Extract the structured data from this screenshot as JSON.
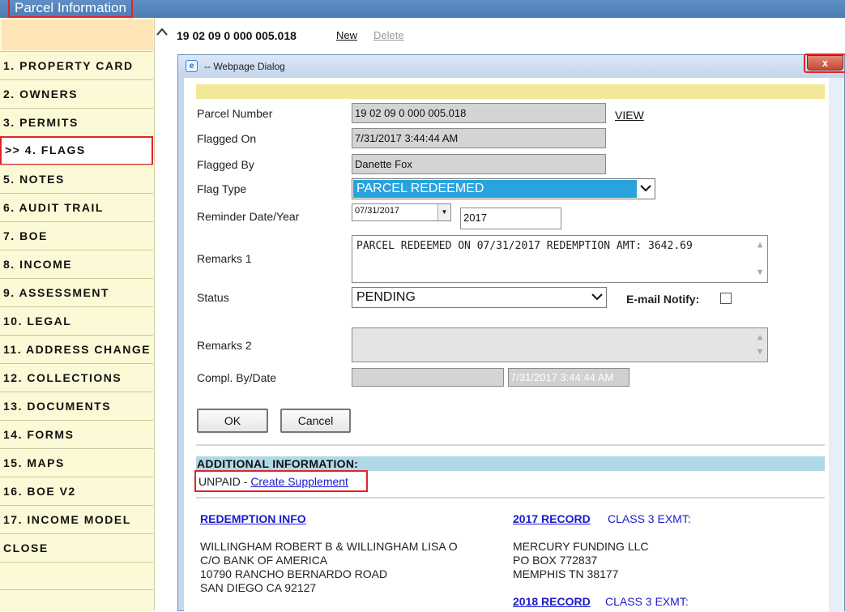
{
  "app": {
    "title": "Parcel Information"
  },
  "nav": {
    "items": [
      {
        "label": "1. PROPERTY CARD"
      },
      {
        "label": "2. OWNERS"
      },
      {
        "label": "3. PERMITS"
      },
      {
        "label": ">> 4. FLAGS"
      },
      {
        "label": "5. NOTES"
      },
      {
        "label": "6. AUDIT TRAIL"
      },
      {
        "label": "7. BOE"
      },
      {
        "label": "8. INCOME"
      },
      {
        "label": "9. ASSESSMENT"
      },
      {
        "label": "10. LEGAL"
      },
      {
        "label": "11. ADDRESS CHANGE"
      },
      {
        "label": "12. COLLECTIONS"
      },
      {
        "label": "13. DOCUMENTS"
      },
      {
        "label": "14. FORMS"
      },
      {
        "label": "15. MAPS"
      },
      {
        "label": "16. BOE V2"
      },
      {
        "label": "17. INCOME MODEL"
      },
      {
        "label": "CLOSE"
      }
    ]
  },
  "page": {
    "parcel_id": "19 02 09 0 000 005.018",
    "new_label": "New",
    "delete_label": "Delete"
  },
  "dialog": {
    "title": "-- Webpage Dialog",
    "close_label": "x",
    "fields": {
      "parcel_number_label": "Parcel Number",
      "parcel_number_value": "19 02 09 0 000 005.018",
      "view_link": "VIEW",
      "flagged_on_label": "Flagged On",
      "flagged_on_value": "7/31/2017 3:44:44 AM",
      "flagged_by_label": "Flagged By",
      "flagged_by_value": "Danette Fox",
      "flag_type_label": "Flag Type",
      "flag_type_value": "PARCEL REDEEMED",
      "reminder_label": "Reminder Date/Year",
      "reminder_date": "07/31/2017",
      "reminder_year": "2017",
      "remarks1_label": "Remarks 1",
      "remarks1_value": "PARCEL REDEEMED ON 07/31/2017 REDEMPTION AMT: 3642.69",
      "status_label": "Status",
      "status_value": "PENDING",
      "email_notify_label": "E-mail Notify:",
      "remarks2_label": "Remarks 2",
      "compl_label": "Compl. By/Date",
      "compl_date": "7/31/2017 3:44:44 AM"
    },
    "buttons": {
      "ok": "OK",
      "cancel": "Cancel"
    },
    "additional": {
      "heading": "ADDITIONAL INFORMATION:",
      "unpaid_prefix": "UNPAID - ",
      "create_supplement": "Create Supplement"
    },
    "redemption": {
      "link": "REDEMPTION INFO",
      "lines": [
        "WILLINGHAM ROBERT B & WILLINGHAM LISA O",
        "C/O BANK OF AMERICA",
        "10790 RANCHO BERNARDO ROAD",
        "SAN DIEGO CA 92127"
      ]
    },
    "record_2017": {
      "link": "2017 RECORD",
      "note": "CLASS 3 EXMT:",
      "lines": [
        "MERCURY FUNDING LLC",
        "PO BOX 772837",
        "MEMPHIS TN 38177"
      ]
    },
    "record_2018": {
      "link": "2018 RECORD",
      "note": "CLASS 3 EXMT:"
    }
  }
}
